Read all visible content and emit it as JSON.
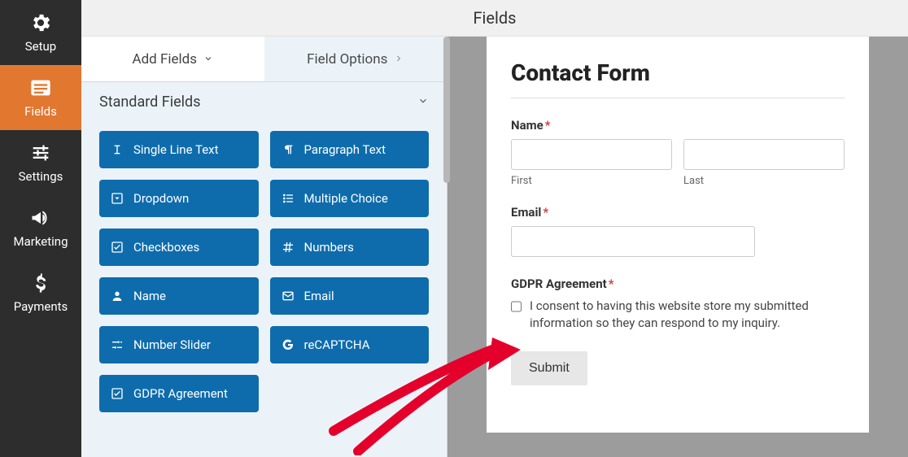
{
  "topbar": {
    "title": "Fields"
  },
  "nav": {
    "items": [
      {
        "label": "Setup",
        "icon": "gear",
        "active": false
      },
      {
        "label": "Fields",
        "icon": "list",
        "active": true
      },
      {
        "label": "Settings",
        "icon": "sliders",
        "active": false
      },
      {
        "label": "Marketing",
        "icon": "bullhorn",
        "active": false
      },
      {
        "label": "Payments",
        "icon": "dollar",
        "active": false
      }
    ]
  },
  "panel": {
    "tabs": {
      "add": {
        "label": "Add Fields"
      },
      "options": {
        "label": "Field Options"
      }
    },
    "group": {
      "title": "Standard Fields"
    },
    "fields": [
      {
        "id": "single-line-text",
        "label": "Single Line Text",
        "icon": "text-cursor"
      },
      {
        "id": "paragraph-text",
        "label": "Paragraph Text",
        "icon": "paragraph"
      },
      {
        "id": "dropdown",
        "label": "Dropdown",
        "icon": "caret-down-sq"
      },
      {
        "id": "multiple-choice",
        "label": "Multiple Choice",
        "icon": "list-ul"
      },
      {
        "id": "checkboxes",
        "label": "Checkboxes",
        "icon": "check-square"
      },
      {
        "id": "numbers",
        "label": "Numbers",
        "icon": "hash"
      },
      {
        "id": "name",
        "label": "Name",
        "icon": "user"
      },
      {
        "id": "email",
        "label": "Email",
        "icon": "envelope"
      },
      {
        "id": "number-slider",
        "label": "Number Slider",
        "icon": "sliders-h"
      },
      {
        "id": "recaptcha",
        "label": "reCAPTCHA",
        "icon": "google"
      },
      {
        "id": "gdpr-agreement",
        "label": "GDPR Agreement",
        "icon": "check-square"
      }
    ]
  },
  "preview": {
    "title": "Contact Form",
    "name": {
      "label": "Name",
      "first_sublabel": "First",
      "last_sublabel": "Last"
    },
    "email": {
      "label": "Email"
    },
    "gdpr": {
      "label": "GDPR Agreement",
      "consent_text": "I consent to having this website store my submitted information so they can respond to my inquiry."
    },
    "submit": {
      "label": "Submit"
    },
    "required_marker": "*"
  }
}
